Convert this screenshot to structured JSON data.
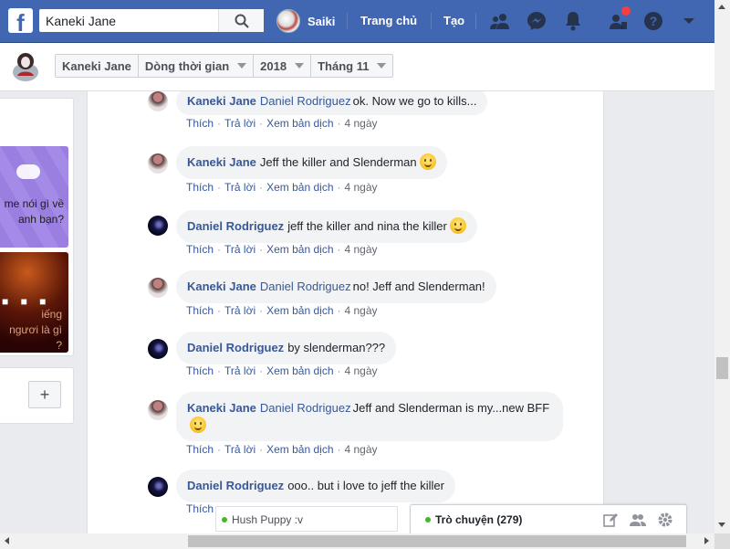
{
  "topbar": {
    "logo": "f",
    "search_value": "Kaneki Jane",
    "user_name": "Saiki",
    "home_label": "Trang chủ",
    "create_label": "Tạo",
    "brand_color": "#4267b2"
  },
  "subheader": {
    "crumbs": [
      "Kaneki Jane",
      "Dòng thời gian",
      "2018",
      "Tháng 11"
    ]
  },
  "left_panel": {
    "tile1_text": "me nói gì về\nanh bạn?",
    "tile2_text": "iếng\nngươi là gì\n?",
    "tile2_dots": "■ ■ ■",
    "add_button": "+"
  },
  "comments": [
    {
      "author": "Kaneki Jane",
      "mention": "Daniel Rodriguez",
      "text": "ok. Now we go to kills...",
      "emoji": false,
      "avatar": "kaneki"
    },
    {
      "author": "Kaneki Jane",
      "mention": "",
      "text": "Jeff the killer and Slenderman",
      "emoji": true,
      "avatar": "kaneki"
    },
    {
      "author": "Daniel Rodriguez",
      "mention": "",
      "text": "jeff the killer and nina the killer",
      "emoji": true,
      "avatar": "daniel"
    },
    {
      "author": "Kaneki Jane",
      "mention": "Daniel Rodriguez",
      "text": "no! Jeff and Slenderman!",
      "emoji": false,
      "avatar": "kaneki"
    },
    {
      "author": "Daniel Rodriguez",
      "mention": "",
      "text": "by slenderman???",
      "emoji": false,
      "avatar": "daniel"
    },
    {
      "author": "Kaneki Jane",
      "mention": "Daniel Rodriguez",
      "text": "Jeff and Slenderman is my...new BFF",
      "emoji": true,
      "avatar": "kaneki"
    },
    {
      "author": "Daniel Rodriguez",
      "mention": "",
      "text": "ooo.. but i love to jeff the killer",
      "emoji": false,
      "avatar": "daniel"
    }
  ],
  "actions": {
    "like": "Thích",
    "reply": "Trả lời",
    "translate": "Xem bản dịch",
    "time": "4 ngày"
  },
  "chat": {
    "small_name": "Hush Puppy :v",
    "label": "Trò chuyện (279)",
    "online_color": "#42b72a"
  }
}
